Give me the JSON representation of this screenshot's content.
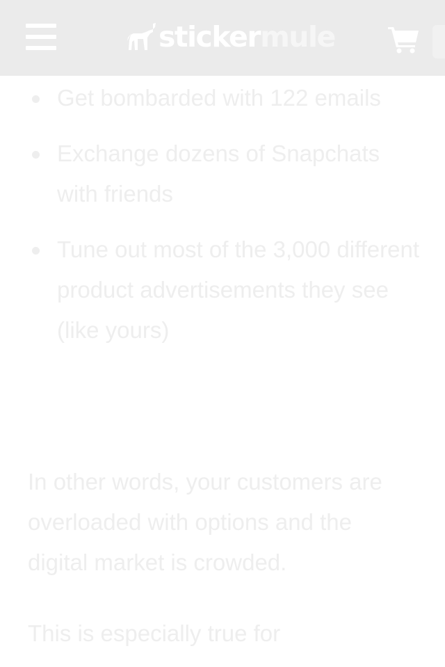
{
  "header": {
    "logo_text_1": "sticker",
    "logo_text_2": "mule",
    "menu_icon": "hamburger-menu-icon",
    "cart_icon": "shopping-cart-icon"
  },
  "article": {
    "bullets": [
      "Get bombarded with 122 emails",
      "Exchange dozens of Snapchats with friends",
      "Tune out most of the 3,000 different product advertisements they see (like yours)"
    ],
    "paragraph_1": "In other words, your customers are overloaded with options and the digital market is crowded.",
    "paragraph_2": "This is especially true for"
  },
  "colors": {
    "header_bg": "#ebebeb",
    "text": "#eeeeee",
    "icon": "#ffffff"
  }
}
